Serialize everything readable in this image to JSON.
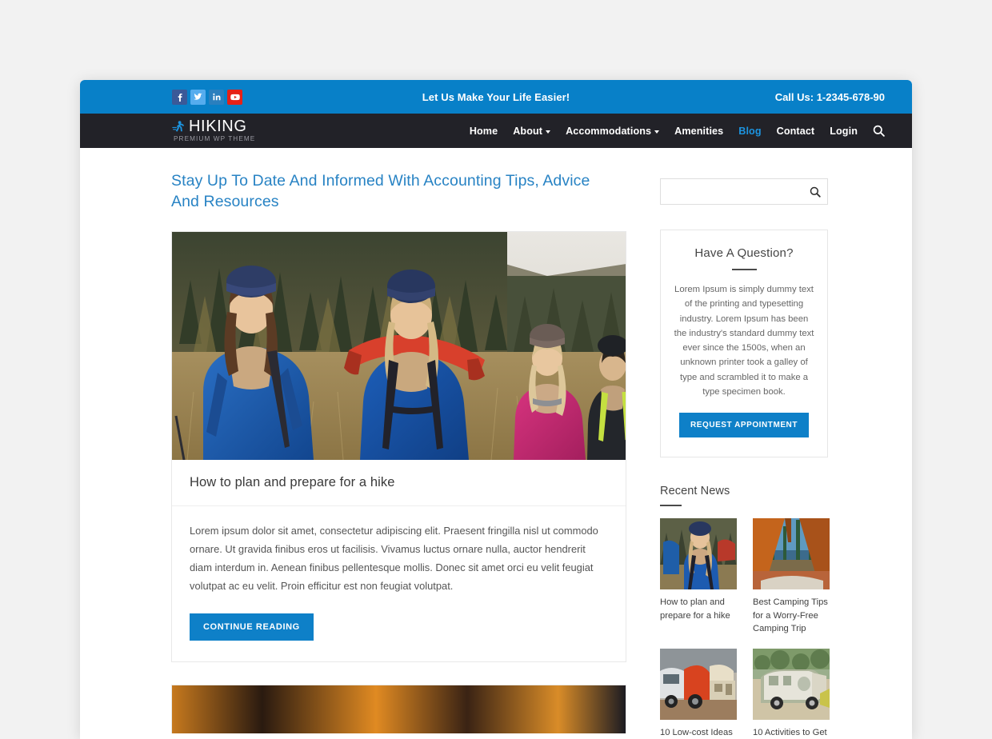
{
  "topbar": {
    "social": [
      {
        "name": "facebook-icon",
        "label": "f",
        "color": "#3b5998"
      },
      {
        "name": "twitter-icon",
        "label": "t",
        "color": "#55acee"
      },
      {
        "name": "linkedin-icon",
        "label": "in",
        "color": "#2a7fbe"
      },
      {
        "name": "youtube-icon",
        "label": "yt",
        "color": "#e62117"
      }
    ],
    "tagline": "Let Us Make Your Life Easier!",
    "call_us": "Call Us: 1-2345-678-90"
  },
  "brand": {
    "name": "HIKING",
    "tagline": "PREMIUM WP THEME",
    "mark": "hiker-icon"
  },
  "nav": {
    "items": [
      {
        "label": "Home",
        "dropdown": false,
        "active": false
      },
      {
        "label": "About",
        "dropdown": true,
        "active": false
      },
      {
        "label": "Accommodations",
        "dropdown": true,
        "active": false
      },
      {
        "label": "Amenities",
        "dropdown": false,
        "active": false
      },
      {
        "label": "Blog",
        "dropdown": false,
        "active": true
      },
      {
        "label": "Contact",
        "dropdown": false,
        "active": false
      },
      {
        "label": "Login",
        "dropdown": false,
        "active": false
      }
    ],
    "search_icon": "search-icon"
  },
  "main": {
    "page_title": "Stay Up To Date And Informed With Accounting Tips, Advice And Resources",
    "post": {
      "image": "hikers-in-mountains-photo",
      "title": "How to plan and prepare for a hike",
      "excerpt": "Lorem ipsum dolor sit amet, consectetur adipiscing elit. Praesent fringilla nisl ut commodo ornare. Ut gravida finibus eros ut facilisis. Vivamus luctus ornare nulla, auctor hendrerit diam interdum in. Aenean finibus pellentesque mollis. Donec sit amet orci eu velit feugiat volutpat ac eu velit. Proin efficitur est non feugiat volutpat.",
      "button": "CONTINUE READING"
    },
    "post2": {
      "image": "campfire-photo"
    }
  },
  "sidebar": {
    "search": {
      "value": "",
      "placeholder": "",
      "icon": "search-icon"
    },
    "question_widget": {
      "title": "Have A Question?",
      "text": "Lorem Ipsum is simply dummy text of the printing and typesetting industry. Lorem Ipsum has been the industry's standard dummy text ever since the 1500s, when an unknown printer took a galley of type and scrambled it to make a type specimen book.",
      "button": "REQUEST APPOINTMENT"
    },
    "recent_news": {
      "heading": "Recent News",
      "items": [
        {
          "title": "How to plan and prepare for a hike",
          "image": "hiker-blue-jacket-thumb"
        },
        {
          "title": "Best Camping Tips for a Worry-Free Camping Trip",
          "image": "tent-interior-thumb"
        },
        {
          "title": "10 Low-cost Ideas",
          "image": "teardrop-trailer-thumb"
        },
        {
          "title": "10 Activities to Get",
          "image": "vintage-camper-thumb"
        }
      ]
    }
  },
  "colors": {
    "accent_blue": "#0880c8",
    "nav_dark": "#222228",
    "title_blue": "#2883c4",
    "active_nav": "#1c94e0",
    "page_bg": "#f2f2f2"
  }
}
